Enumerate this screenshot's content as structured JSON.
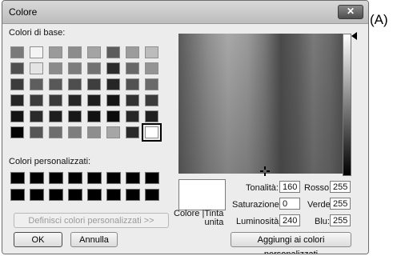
{
  "window": {
    "title": "Colore",
    "close_glyph": "✕"
  },
  "annotation": "(A)",
  "basic": {
    "label": "Colori di base:",
    "swatches": [
      "#7a7a7a",
      "#f4f4f4",
      "#9a9a9a",
      "#8c8c8c",
      "#a4a4a4",
      "#5c5c5c",
      "#9c9c9c",
      "#bcbcbc",
      "#505050",
      "#e4e4e4",
      "#8a8a8a",
      "#7c7c7c",
      "#727272",
      "#2c2c2c",
      "#686868",
      "#949494",
      "#3c3c3c",
      "#5e5e5e",
      "#585858",
      "#4e4e4e",
      "#3e3e3e",
      "#262626",
      "#525252",
      "#6a6a6a",
      "#262626",
      "#3c3c3c",
      "#3a3a3a",
      "#262626",
      "#1e1e1e",
      "#161616",
      "#323232",
      "#3c3c3c",
      "#141414",
      "#2a2a2a",
      "#1e1e1e",
      "#181818",
      "#121212",
      "#0c0c0c",
      "#282828",
      "#202020",
      "#050505",
      "#565656",
      "#6e6e6e",
      "#7e7e7e",
      "#8e8e8e",
      "#a6a6a6",
      "#2a2a2a",
      "#ffffff"
    ],
    "selected_index": 47
  },
  "custom": {
    "label": "Colori personalizzati:",
    "count": 16
  },
  "buttons": {
    "define_custom": "Definisci colori personalizzati >>",
    "ok": "OK",
    "cancel": "Annulla",
    "add_custom": "Aggiungi ai colori personalizzati"
  },
  "preview": {
    "label": "Colore |Tinta\nunita"
  },
  "fields": {
    "hue": {
      "label": "Tonalità:",
      "value": "160"
    },
    "saturation": {
      "label": "Saturazione:",
      "value": "0"
    },
    "luminosity": {
      "label": "Luminosità:",
      "value": "240"
    },
    "red": {
      "label": "Rosso:",
      "value": "255"
    },
    "green": {
      "label": "Verde:",
      "value": "255"
    },
    "blue": {
      "label": "Blu:",
      "value": "255"
    }
  }
}
